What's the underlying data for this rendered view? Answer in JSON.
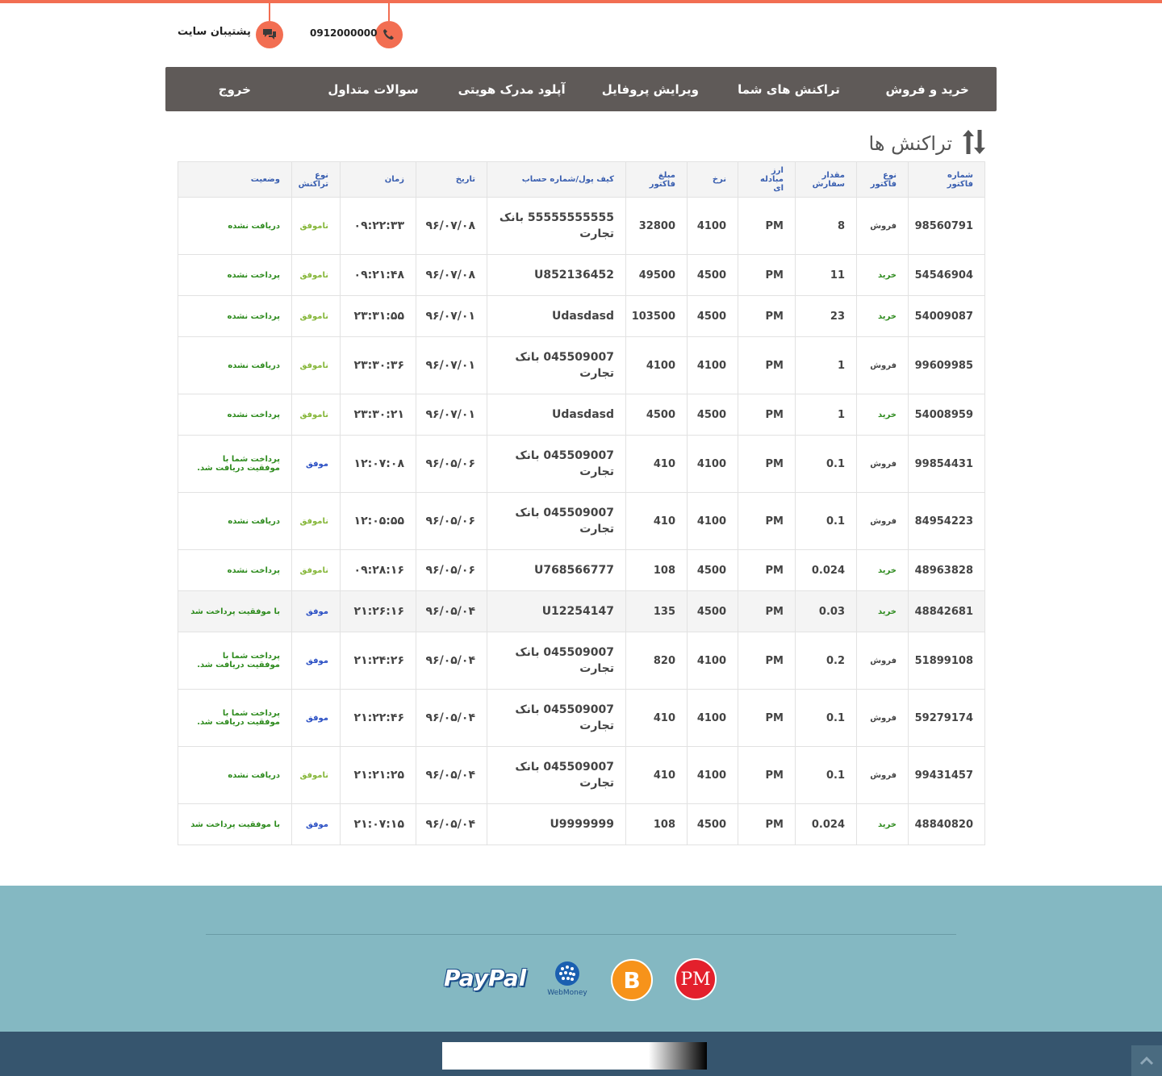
{
  "header": {
    "support_label": "پشتیبان سایت",
    "phone": "0912000000",
    "support_icon": "chat-icon",
    "phone_icon": "phone-icon",
    "accent_color": "#f26e52"
  },
  "nav": {
    "items": [
      {
        "label": "خرید و فروش"
      },
      {
        "label": "تراکنش های شما"
      },
      {
        "label": "ویرایش پروفایل"
      },
      {
        "label": "آپلود مدرک هویتی"
      },
      {
        "label": "سوالات متداول"
      },
      {
        "label": "خروج"
      }
    ]
  },
  "page": {
    "title": "تراکنش   ها",
    "title_icon": "sort-arrows-icon"
  },
  "table": {
    "headers": [
      "شماره فاکتور",
      "نوع فاکتور",
      "مقدار سفارش",
      "ارز مبادله ای",
      "نرخ",
      "مبلغ فاکتور",
      "کیف پول/شماره حساب",
      "تاریخ",
      "زمان",
      "نوع تراکنش",
      "وضعیت"
    ],
    "rows": [
      {
        "invoice": "98560791",
        "type": "فروش",
        "amount": "8",
        "currency": "PM",
        "rate": "4100",
        "total": "32800",
        "wallet": "55555555555 بانک تجارت",
        "date": "۹۶/۰۷/۰۸",
        "time": "۰۹:۲۲:۳۳",
        "tx": "ناموفق",
        "status": "دریافت نشده"
      },
      {
        "invoice": "54546904",
        "type": "خرید",
        "amount": "11",
        "currency": "PM",
        "rate": "4500",
        "total": "49500",
        "wallet": "U852136452",
        "date": "۹۶/۰۷/۰۸",
        "time": "۰۹:۲۱:۴۸",
        "tx": "ناموفق",
        "status": "پرداخت نشده"
      },
      {
        "invoice": "54009087",
        "type": "خرید",
        "amount": "23",
        "currency": "PM",
        "rate": "4500",
        "total": "103500",
        "wallet": "Udasdasd",
        "date": "۹۶/۰۷/۰۱",
        "time": "۲۳:۳۱:۵۵",
        "tx": "ناموفق",
        "status": "پرداخت نشده"
      },
      {
        "invoice": "99609985",
        "type": "فروش",
        "amount": "1",
        "currency": "PM",
        "rate": "4100",
        "total": "4100",
        "wallet": "045509007 بانک تجارت",
        "date": "۹۶/۰۷/۰۱",
        "time": "۲۳:۳۰:۳۶",
        "tx": "ناموفق",
        "status": "دریافت نشده"
      },
      {
        "invoice": "54008959",
        "type": "خرید",
        "amount": "1",
        "currency": "PM",
        "rate": "4500",
        "total": "4500",
        "wallet": "Udasdasd",
        "date": "۹۶/۰۷/۰۱",
        "time": "۲۳:۳۰:۲۱",
        "tx": "ناموفق",
        "status": "پرداخت نشده"
      },
      {
        "invoice": "99854431",
        "type": "فروش",
        "amount": "0.1",
        "currency": "PM",
        "rate": "4100",
        "total": "410",
        "wallet": "045509007 بانک تجارت",
        "date": "۹۶/۰۵/۰۶",
        "time": "۱۲:۰۷:۰۸",
        "tx": "موفق",
        "status": "پرداخت شما با موفقیت دریافت شد."
      },
      {
        "invoice": "84954223",
        "type": "فروش",
        "amount": "0.1",
        "currency": "PM",
        "rate": "4100",
        "total": "410",
        "wallet": "045509007 بانک تجارت",
        "date": "۹۶/۰۵/۰۶",
        "time": "۱۲:۰۵:۵۵",
        "tx": "ناموفق",
        "status": "دریافت نشده"
      },
      {
        "invoice": "48963828",
        "type": "خرید",
        "amount": "0.024",
        "currency": "PM",
        "rate": "4500",
        "total": "108",
        "wallet": "U768566777",
        "date": "۹۶/۰۵/۰۶",
        "time": "۰۹:۲۸:۱۶",
        "tx": "ناموفق",
        "status": "پرداخت نشده"
      },
      {
        "invoice": "48842681",
        "type": "خرید",
        "amount": "0.03",
        "currency": "PM",
        "rate": "4500",
        "total": "135",
        "wallet": "U12254147",
        "date": "۹۶/۰۵/۰۴",
        "time": "۲۱:۲۶:۱۶",
        "tx": "موفق",
        "status": "با موفقیت پرداخت شد"
      },
      {
        "invoice": "51899108",
        "type": "فروش",
        "amount": "0.2",
        "currency": "PM",
        "rate": "4100",
        "total": "820",
        "wallet": "045509007 بانک تجارت",
        "date": "۹۶/۰۵/۰۴",
        "time": "۲۱:۲۴:۲۶",
        "tx": "موفق",
        "status": "پرداخت شما با موفقیت دریافت شد."
      },
      {
        "invoice": "59279174",
        "type": "فروش",
        "amount": "0.1",
        "currency": "PM",
        "rate": "4100",
        "total": "410",
        "wallet": "045509007 بانک تجارت",
        "date": "۹۶/۰۵/۰۴",
        "time": "۲۱:۲۲:۴۶",
        "tx": "موفق",
        "status": "پرداخت شما با موفقیت دریافت شد."
      },
      {
        "invoice": "99431457",
        "type": "فروش",
        "amount": "0.1",
        "currency": "PM",
        "rate": "4100",
        "total": "410",
        "wallet": "045509007 بانک تجارت",
        "date": "۹۶/۰۵/۰۴",
        "time": "۲۱:۲۱:۲۵",
        "tx": "ناموفق",
        "status": "دریافت نشده"
      },
      {
        "invoice": "48840820",
        "type": "خرید",
        "amount": "0.024",
        "currency": "PM",
        "rate": "4500",
        "total": "108",
        "wallet": "U9999999",
        "date": "۹۶/۰۵/۰۴",
        "time": "۲۱:۰۷:۱۵",
        "tx": "موفق",
        "status": "با موفقیت پرداخت شد"
      }
    ]
  },
  "footer": {
    "bg_color": "#84b8c2",
    "bottom_color": "#36556e",
    "logos": [
      {
        "icon": "paypal-logo-icon",
        "text": "PayPal"
      },
      {
        "icon": "webmoney-logo-icon",
        "text": "WebMoney"
      },
      {
        "icon": "bitcoin-logo-icon",
        "text": "B"
      },
      {
        "icon": "perfect-money-logo-icon",
        "text": "PM"
      }
    ],
    "scroll_icon": "chevron-up-icon"
  }
}
